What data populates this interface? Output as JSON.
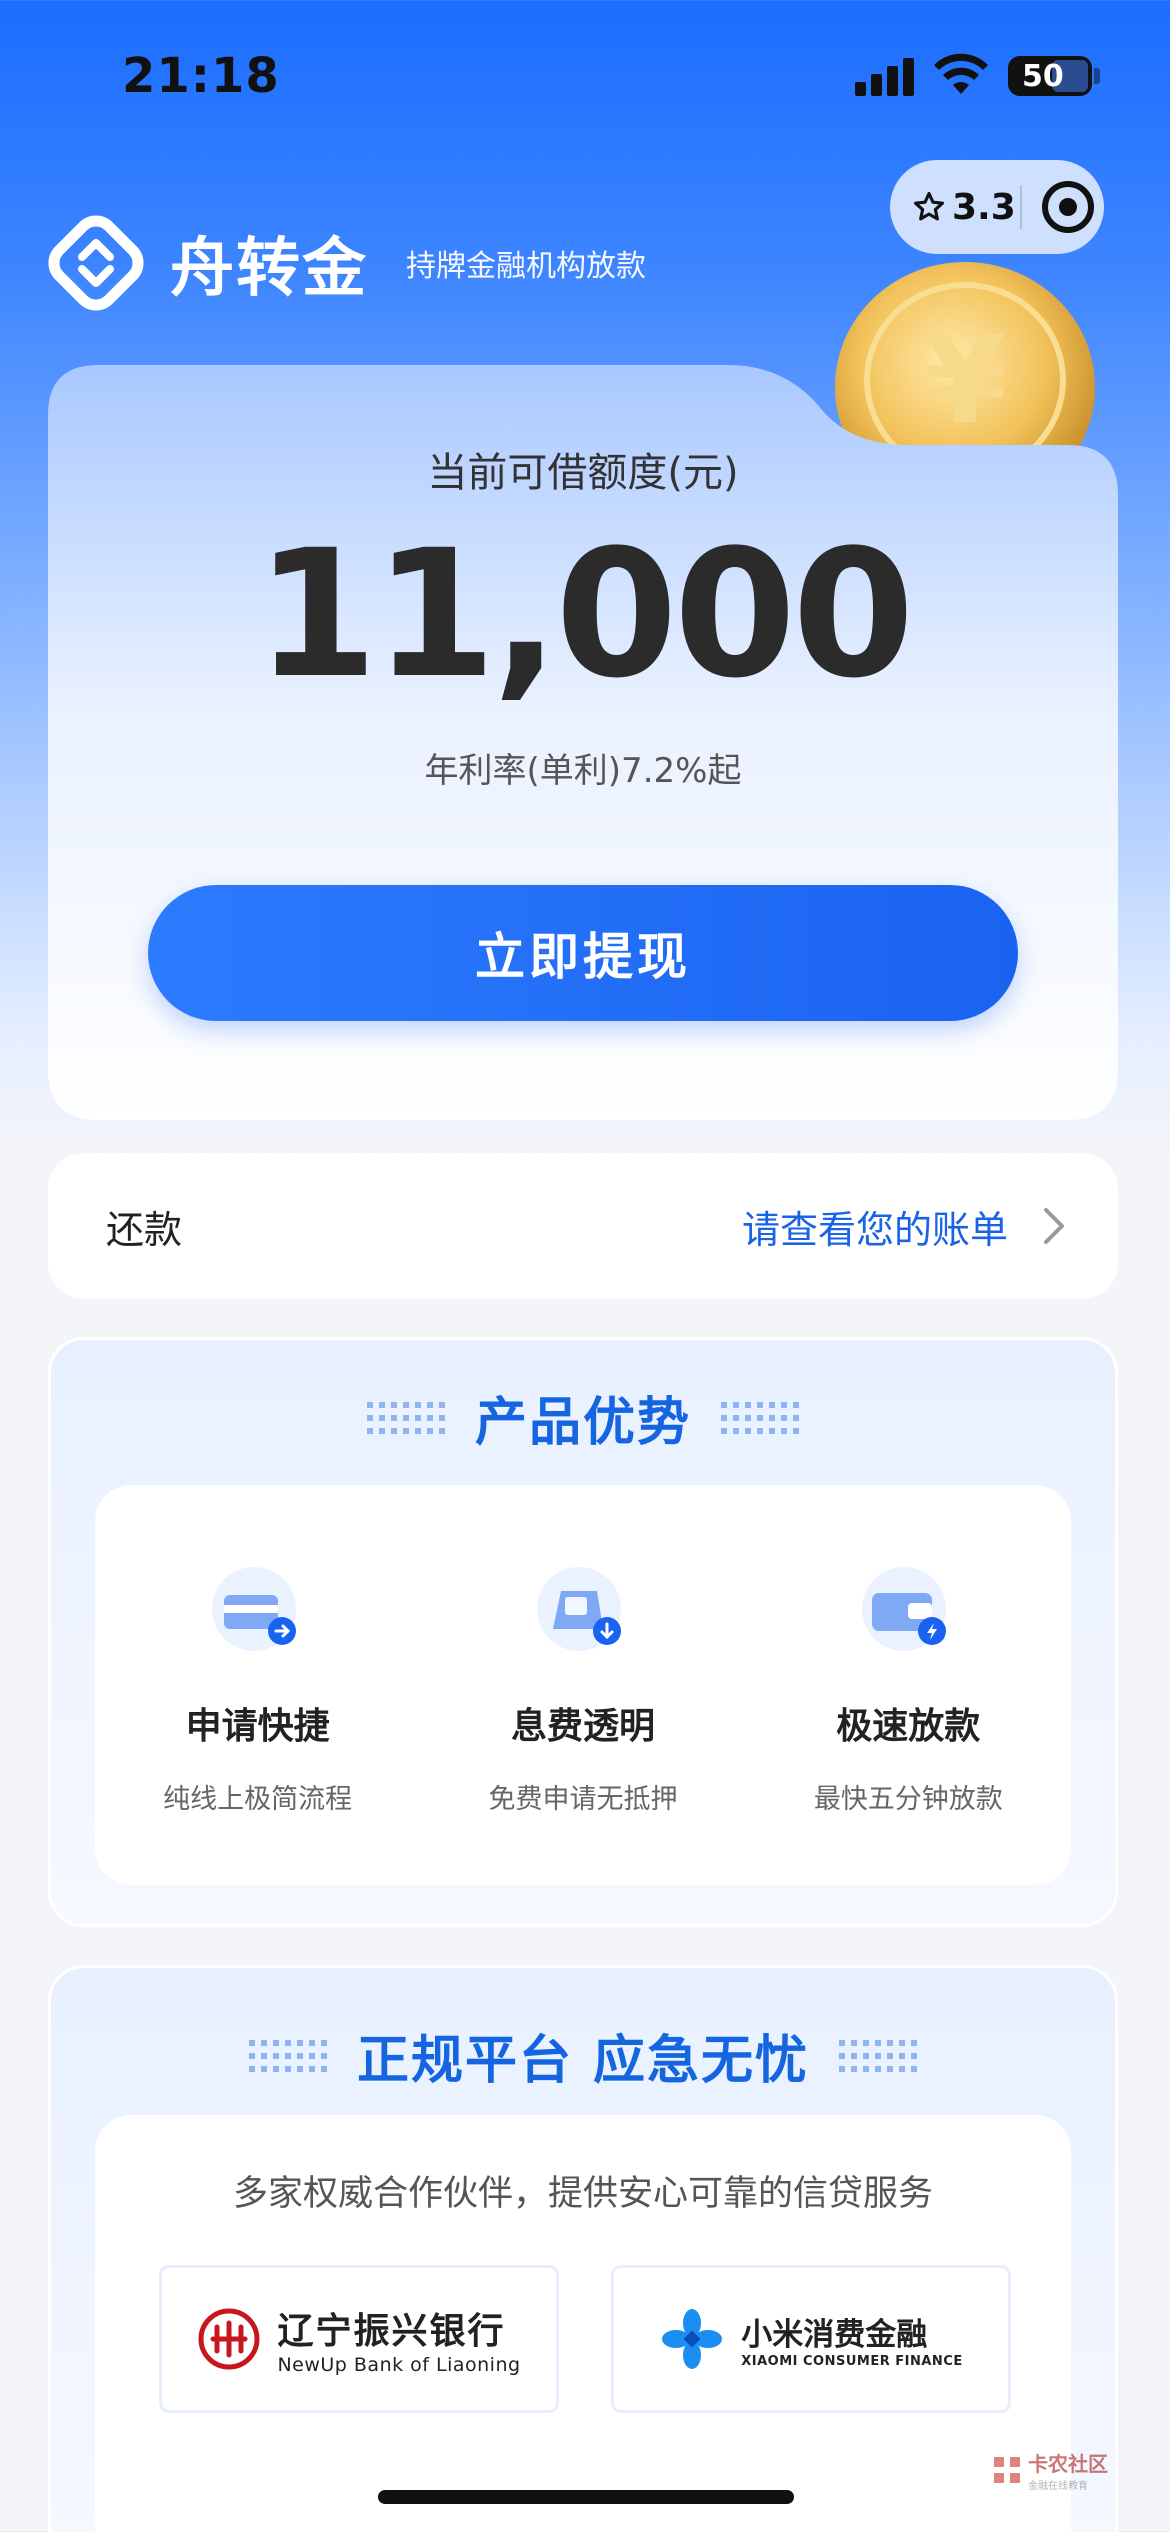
{
  "status_bar": {
    "time": "21:18",
    "battery": "50"
  },
  "capsule": {
    "rating": "3.3"
  },
  "brand": {
    "name": "舟转金",
    "subtitle": "持牌金融机构放款"
  },
  "hero": {
    "label": "当前可借额度(元)",
    "amount": "11,000",
    "rate": "年利率(单利)7.2%起",
    "cta": "立即提现"
  },
  "repay": {
    "label": "还款",
    "link": "请查看您的账单"
  },
  "advantages": {
    "title": "产品优势",
    "items": [
      {
        "title": "申请快捷",
        "desc": "纯线上极简流程",
        "icon": "card-arrow-icon"
      },
      {
        "title": "息费透明",
        "desc": "免费申请无抵押",
        "icon": "transparent-fee-icon"
      },
      {
        "title": "极速放款",
        "desc": "最快五分钟放款",
        "icon": "wallet-lightning-icon"
      }
    ]
  },
  "platform": {
    "title": "正规平台 应急无忧",
    "desc": "多家权威合作伙伴，提供安心可靠的信贷服务",
    "partners": [
      {
        "name_cn": "辽宁振兴银行",
        "name_en": "NewUp Bank of Liaoning"
      },
      {
        "name_cn": "小米消费金融",
        "name_en": "XIAOMI CONSUMER FINANCE"
      }
    ]
  },
  "watermark": {
    "main": "卡农社区",
    "sub": "金融在线教育"
  },
  "colors": {
    "brand_blue": "#1a63f0",
    "link_blue": "#1a63e6",
    "title_blue": "#1565e0"
  }
}
